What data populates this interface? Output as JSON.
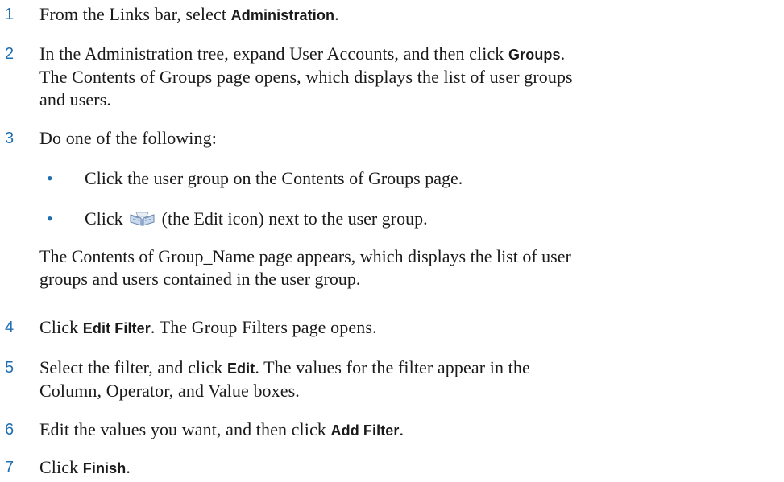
{
  "steps": [
    {
      "number": "1",
      "prefix": "From the Links bar, select ",
      "ui": "Administration",
      "suffix": "."
    },
    {
      "number": "2",
      "prefix": "In the Administration tree, expand User Accounts, and then click ",
      "ui": "Groups",
      "suffix": ".",
      "line2": "The Contents of Groups page opens, which displays the list of user groups",
      "line3": "and users."
    },
    {
      "number": "3",
      "text": "Do one of the following:",
      "bullets": [
        {
          "text": "Click the user group on the Contents of Groups page."
        },
        {
          "before": "Click ",
          "icon": "edit-icon",
          "after": " (the Edit icon) next to the user group."
        }
      ],
      "para_line1": "The Contents of Group_Name page appears, which displays the list of user",
      "para_line2": "groups and users contained in the user group."
    },
    {
      "number": "4",
      "ui": "Edit Filter",
      "prefix": "Click ",
      "suffix": ". The Group Filters page opens."
    },
    {
      "number": "5",
      "prefix": "Select the filter, and click ",
      "ui": "Edit",
      "suffix": ". The values for the filter appear in the",
      "line2": "Column, Operator, and Value boxes."
    },
    {
      "number": "6",
      "prefix": "Edit the values you want, and then click ",
      "ui": "Add Filter",
      "suffix": "."
    },
    {
      "number": "7",
      "prefix": "Click ",
      "ui": "Finish",
      "suffix": "."
    }
  ],
  "colors": {
    "step_number": "#1f6fb3",
    "text": "#1a1a1a"
  }
}
